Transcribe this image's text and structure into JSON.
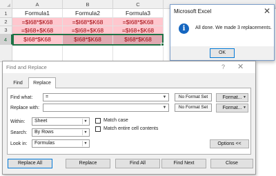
{
  "spreadsheet": {
    "columns": [
      "A",
      "B",
      "C"
    ],
    "rows": [
      "1",
      "2",
      "3",
      "4"
    ],
    "header_row": [
      "Formula1",
      "Formula2",
      "Formula3"
    ],
    "data_rows": [
      [
        "=$I68*$K68",
        "=$I68*$K68",
        "=$I68*$K68"
      ],
      [
        "=$I68+$K68",
        "=$I68+$K68",
        "=$I68+$K68"
      ],
      [
        "$I68*$K68",
        "$I68*$K68",
        "$I68*$K68"
      ]
    ],
    "selected_row": "4",
    "highlight_colors": {
      "fill": "#ffc7ce",
      "text": "#9c0006",
      "selection": "#1e7145"
    }
  },
  "message_box": {
    "title": "Microsoft Excel",
    "icon": "information-icon",
    "message": "All done. We made 3 replacements.",
    "ok_label": "OK",
    "close_glyph": "✕"
  },
  "find_replace": {
    "title": "Find and Replace",
    "help_glyph": "?",
    "close_glyph": "✕",
    "tabs": {
      "find": "Find",
      "replace": "Replace"
    },
    "active_tab": "Replace",
    "find_what": {
      "label": "Find what:",
      "value": "=",
      "format_status": "No Format Set",
      "format_button": "Format..."
    },
    "replace_with": {
      "label": "Replace with:",
      "value": "",
      "format_status": "No Format Set",
      "format_button": "Format..."
    },
    "within": {
      "label": "Within:",
      "value": "Sheet"
    },
    "search": {
      "label": "Search:",
      "value": "By Rows"
    },
    "look_in": {
      "label": "Look in:",
      "value": "Formulas"
    },
    "match_case": {
      "label": "Match case",
      "checked": false
    },
    "match_entire": {
      "label": "Match entire cell contents",
      "checked": false
    },
    "options_button": "Options <<",
    "buttons": {
      "replace_all": "Replace All",
      "replace": "Replace",
      "find_all": "Find All",
      "find_next": "Find Next",
      "close": "Close"
    }
  }
}
